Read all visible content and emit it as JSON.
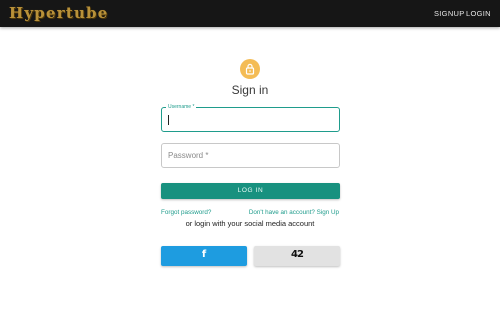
{
  "header": {
    "logo": "Hypertube",
    "nav": {
      "signup": "SIGNUP",
      "login": "LOGIN"
    }
  },
  "form": {
    "lock_icon": "lock-icon",
    "title": "Sign in",
    "username": {
      "label": "Username *",
      "value": "",
      "placeholder": ""
    },
    "password": {
      "placeholder": "Password *",
      "value": ""
    },
    "login_label": "LOG IN",
    "forgot_label": "Forgot password?",
    "signup_label": "Don't have an account? Sign Up",
    "social_text": "or login with your social media account",
    "facebook_icon": "facebook-icon",
    "facebook_glyph": "f",
    "fortytwo_icon": "42-icon",
    "fortytwo_glyph": "42"
  },
  "colors": {
    "accent": "#1f9c8c",
    "topbar": "#161616",
    "logo": "#b8913a",
    "lock_avatar": "#f4bc55",
    "facebook": "#1e9ce0",
    "fortytwo": "#e2e2e2"
  }
}
